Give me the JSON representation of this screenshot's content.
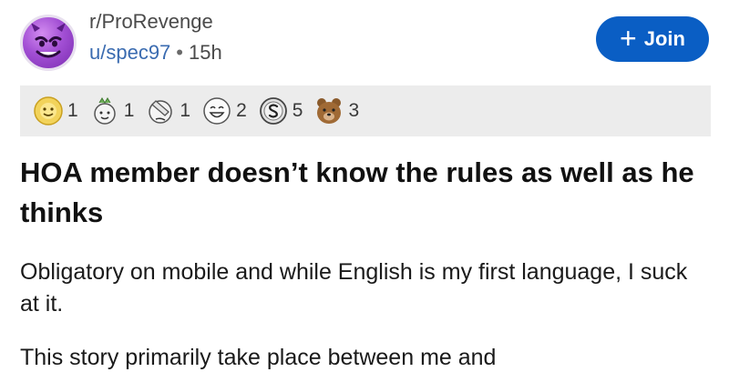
{
  "header": {
    "subreddit": "r/ProRevenge",
    "username": "u/spec97",
    "separator": "•",
    "age": "15h",
    "join_plus": "+",
    "join_label": "Join"
  },
  "awards": [
    {
      "icon": "sun-award-icon",
      "count": "1"
    },
    {
      "icon": "wholesome-award-icon",
      "count": "1"
    },
    {
      "icon": "facepalm-award-icon",
      "count": "1"
    },
    {
      "icon": "laughing-award-icon",
      "count": "2"
    },
    {
      "icon": "silver-award-icon",
      "count": "5"
    },
    {
      "icon": "bear-award-icon",
      "count": "3"
    }
  ],
  "post": {
    "title": "HOA member doesn’t know the rules as well as he thinks",
    "paragraph1": "Obligatory on mobile and while English is my first language, I suck at it.",
    "paragraph2": "This story primarily take place between me and"
  },
  "colors": {
    "join_button": "#0a5ec4",
    "username": "#3a6bb0",
    "awards_bar": "#ececec",
    "avatar": "#a24fd4"
  }
}
